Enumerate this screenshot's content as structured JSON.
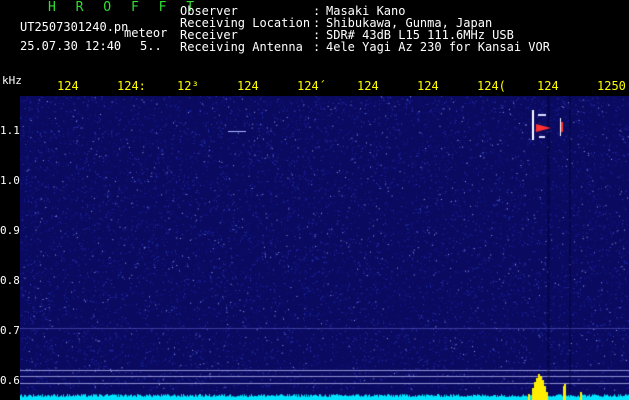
{
  "header": {
    "brand": "H R O F F T",
    "file_name": "UT2507301240.pn",
    "meteor_label": "meteor",
    "date_time": "25.07.30 12:40",
    "count": "5..",
    "fields": [
      {
        "label": "Observer",
        "value": "Masaki Kano"
      },
      {
        "label": "Receiving Location",
        "value": "Shibukawa, Gunma, Japan"
      },
      {
        "label": "Receiver",
        "value": "SDR# 43dB L15 111.6MHz USB"
      },
      {
        "label": "Receiving Antenna",
        "value": "4ele Yagi Az 230 for Kansai VOR"
      }
    ]
  },
  "colors": {
    "brand": "#33dd33",
    "text": "#ffffff",
    "tick": "#ffff00",
    "background": "#000000",
    "spectrogram_bg": "#0a0a60",
    "baseline": "#00e5ff",
    "echo_yellow": "#ffee00"
  },
  "chart_data": {
    "type": "heatmap",
    "y_unit_label": "kHz",
    "y_ticks": [
      "1.1",
      "1.0",
      "0.9",
      "0.8",
      "0.7",
      "0.6"
    ],
    "x_ticks": [
      "124",
      "124",
      "124",
      "124",
      "124",
      "124",
      "124",
      "124",
      "124",
      "1250"
    ],
    "x_tick_display": [
      "124",
      "124:",
      "12³",
      "124",
      "124´",
      "124",
      "124",
      "124(",
      "124",
      "1250"
    ]
  }
}
